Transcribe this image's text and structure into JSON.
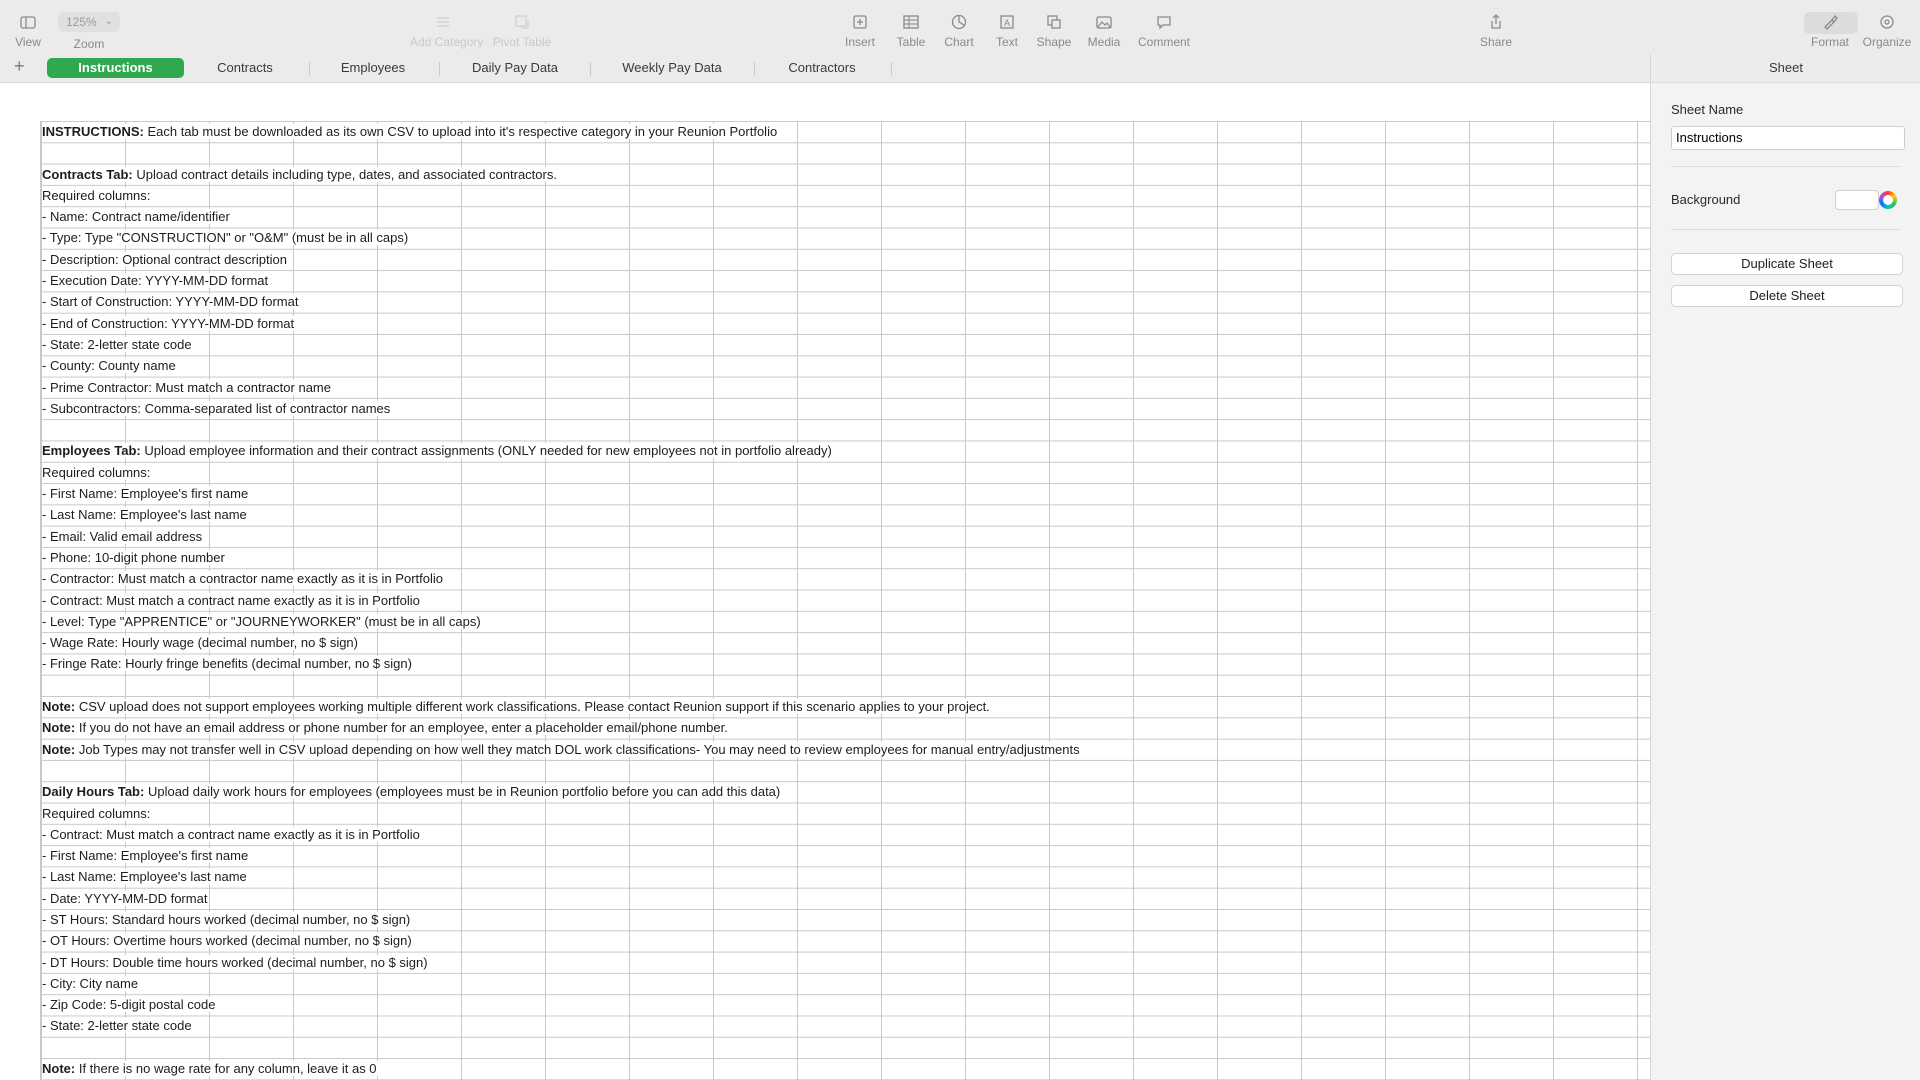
{
  "toolbar": {
    "view_label": "View",
    "zoom_value": "125%",
    "zoom_label": "Zoom",
    "add_category_label": "Add Category",
    "pivot_table_label": "Pivot Table",
    "insert_label": "Insert",
    "table_label": "Table",
    "chart_label": "Chart",
    "text_label": "Text",
    "shape_label": "Shape",
    "media_label": "Media",
    "comment_label": "Comment",
    "share_label": "Share",
    "format_label": "Format",
    "organize_label": "Organize"
  },
  "tabs": [
    {
      "label": "Instructions",
      "active": true
    },
    {
      "label": "Contracts"
    },
    {
      "label": "Employees"
    },
    {
      "label": "Daily Pay Data"
    },
    {
      "label": "Weekly Pay Data"
    },
    {
      "label": "Contractors"
    }
  ],
  "sidebar": {
    "header": "Sheet",
    "sheet_name_label": "Sheet Name",
    "sheet_name_value": "Instructions",
    "background_label": "Background",
    "duplicate_label": "Duplicate Sheet",
    "delete_label": "Delete Sheet"
  },
  "accent_color": "#2fa84f",
  "rows": [
    {
      "bold": "INSTRUCTIONS:",
      "text": " Each tab must be downloaded as its own CSV to upload into it's respective category in your Reunion Portfolio"
    },
    {
      "bold": "",
      "text": ""
    },
    {
      "bold": "Contracts Tab:",
      "text": " Upload contract details including type, dates, and associated contractors."
    },
    {
      "bold": "",
      "text": "Required columns:"
    },
    {
      "bold": "",
      "text": "- Name: Contract name/identifier"
    },
    {
      "bold": "",
      "text": "- Type: Type \"CONSTRUCTION\" or \"O&M\" (must be in all caps)"
    },
    {
      "bold": "",
      "text": "- Description: Optional contract description"
    },
    {
      "bold": "",
      "text": "- Execution Date: YYYY-MM-DD format"
    },
    {
      "bold": "",
      "text": "- Start of Construction: YYYY-MM-DD format"
    },
    {
      "bold": "",
      "text": "- End of Construction: YYYY-MM-DD format"
    },
    {
      "bold": "",
      "text": "- State: 2-letter state code"
    },
    {
      "bold": "",
      "text": "- County: County name"
    },
    {
      "bold": "",
      "text": "- Prime Contractor: Must match a contractor name"
    },
    {
      "bold": "",
      "text": "- Subcontractors: Comma-separated list of contractor names"
    },
    {
      "bold": "",
      "text": ""
    },
    {
      "bold": "Employees Tab:",
      "text": " Upload employee information and their contract assignments (ONLY needed for new employees not in portfolio already)"
    },
    {
      "bold": "",
      "text": "Required columns:"
    },
    {
      "bold": "",
      "text": "- First Name: Employee's first name"
    },
    {
      "bold": "",
      "text": "- Last Name: Employee's last name"
    },
    {
      "bold": "",
      "text": "- Email: Valid email address"
    },
    {
      "bold": "",
      "text": "- Phone: 10-digit phone number"
    },
    {
      "bold": "",
      "text": "- Contractor: Must match a contractor name exactly as it is in Portfolio"
    },
    {
      "bold": "",
      "text": "- Contract: Must match a contract name exactly as it is in Portfolio"
    },
    {
      "bold": "",
      "text": "- Level: Type \"APPRENTICE\" or \"JOURNEYWORKER\" (must be in all caps)"
    },
    {
      "bold": "",
      "text": "- Wage Rate: Hourly wage (decimal number, no $ sign)"
    },
    {
      "bold": "",
      "text": "- Fringe Rate: Hourly fringe benefits (decimal number, no $ sign)"
    },
    {
      "bold": "",
      "text": ""
    },
    {
      "bold": "Note:",
      "text": " CSV upload does not support employees working multiple different work classifications. Please contact Reunion support if this scenario applies to your project."
    },
    {
      "bold": "Note:",
      "text": " If you do not have an email address or phone number for an employee, enter a placeholder email/phone number."
    },
    {
      "bold": "Note:",
      "text": " Job Types may not transfer well in CSV upload depending on how well they match DOL work classifications- You may need to review employees for manual entry/adjustments"
    },
    {
      "bold": "",
      "text": ""
    },
    {
      "bold": "Daily Hours Tab:",
      "text": " Upload daily work hours for employees (employees must be in Reunion portfolio before you can add this data)"
    },
    {
      "bold": "",
      "text": "Required columns:"
    },
    {
      "bold": "",
      "text": "- Contract: Must match a contract name exactly as it is in Portfolio"
    },
    {
      "bold": "",
      "text": "- First Name: Employee's first name"
    },
    {
      "bold": "",
      "text": "- Last Name: Employee's last name"
    },
    {
      "bold": "",
      "text": "- Date: YYYY-MM-DD format"
    },
    {
      "bold": "",
      "text": "- ST Hours: Standard hours worked (decimal number, no $ sign)"
    },
    {
      "bold": "",
      "text": "- OT Hours: Overtime hours worked (decimal number, no $ sign)"
    },
    {
      "bold": "",
      "text": "- DT Hours: Double time hours worked (decimal number, no $ sign)"
    },
    {
      "bold": "",
      "text": "- City: City name"
    },
    {
      "bold": "",
      "text": "- Zip Code: 5-digit postal code"
    },
    {
      "bold": "",
      "text": "- State: 2-letter state code"
    },
    {
      "bold": "",
      "text": ""
    },
    {
      "bold": "Note:",
      "text": " If there is no wage rate for any column, leave it as 0"
    }
  ]
}
